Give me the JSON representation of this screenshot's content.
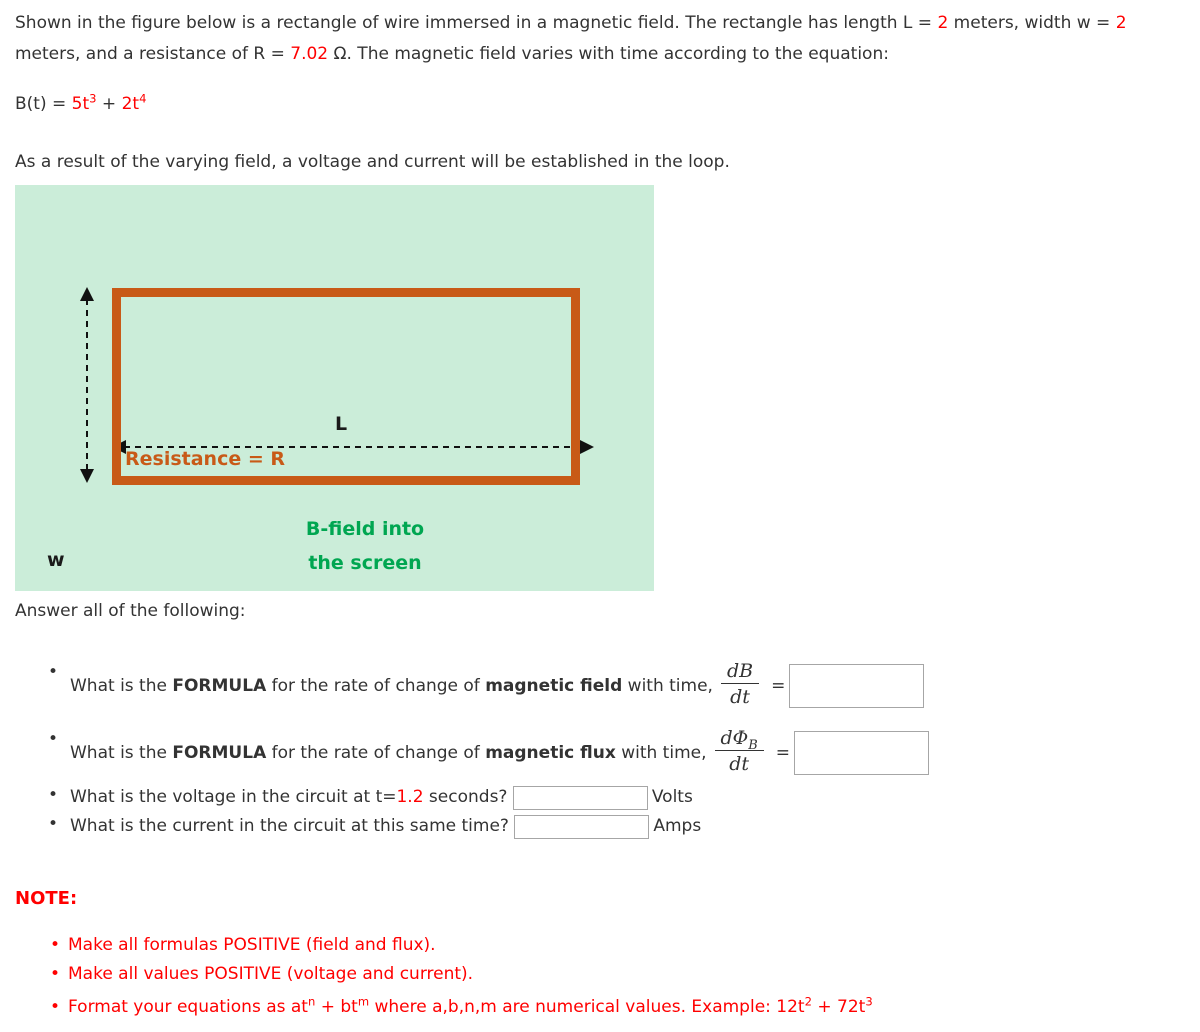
{
  "problem": {
    "intro_before_L": "Shown in the figure below is a rectangle of wire immersed in a magnetic field. The rectangle has length L = ",
    "length_value": "2",
    "intro_mid_1": " meters, width w = ",
    "width_value": "2",
    "intro_mid_2": " meters, and a resistance of R = ",
    "resistance_value": "7.02",
    "intro_after_R": " Ω. The magnetic field varies with time according to the equation:",
    "equation_lhs": "B(t) = ",
    "equation_term1_coeff": "5",
    "equation_term1_var": "t",
    "equation_term1_exp": "3",
    "equation_plus": " + ",
    "equation_term2_coeff": "2",
    "equation_term2_var": "t",
    "equation_term2_exp": "4",
    "result_text": "As a result of the varying field, a voltage and current will be established in the loop.",
    "answer_intro": "Answer all of the following:"
  },
  "figure": {
    "length_label": "L",
    "width_label": "w",
    "resistance_label": "Resistance = R",
    "bfield_label_line1": "B-field into",
    "bfield_label_line2": "the screen",
    "background_color": "#cbedd9",
    "loop_color": "#c85a17",
    "bfield_text_color": "#00a651"
  },
  "questions": [
    {
      "text_1": "What is the ",
      "bold_1": "FORMULA",
      "text_2": " for the rate of change of ",
      "bold_2": "magnetic field",
      "text_3": " with time,",
      "fraction_num": "dB",
      "fraction_den": "dt",
      "equals": "=",
      "value": ""
    },
    {
      "text_1": "What is the ",
      "bold_1": "FORMULA",
      "text_2": " for the rate of change of ",
      "bold_2": "magnetic flux",
      "text_3": " with time,",
      "fraction_num_d": "dΦ",
      "fraction_num_sub": "B",
      "fraction_den": "dt",
      "equals": "=",
      "value": ""
    }
  ],
  "numeric_questions": [
    {
      "text_before": "What is the voltage in the circuit at t=",
      "time_value": "1.2",
      "text_after": " seconds?",
      "value": "",
      "unit": "Volts"
    },
    {
      "text_before": "What is the current in the circuit at this same time?",
      "time_value": "",
      "text_after": "",
      "value": "",
      "unit": "Amps"
    }
  ],
  "note": {
    "heading": "NOTE:",
    "color": "#ff0000",
    "bullets": [
      "Make all formulas POSITIVE (field and flux).",
      "Make all values POSITIVE (voltage and current)."
    ],
    "format_bullet": {
      "text_1": "Format your equations as at",
      "exp_1": "n",
      "text_2": " + bt",
      "exp_2": "m",
      "text_3": " where a,b,n,m are numerical values. Example: 12t",
      "exp_3": "2",
      "text_4": " + 72t",
      "exp_4": "3"
    }
  }
}
